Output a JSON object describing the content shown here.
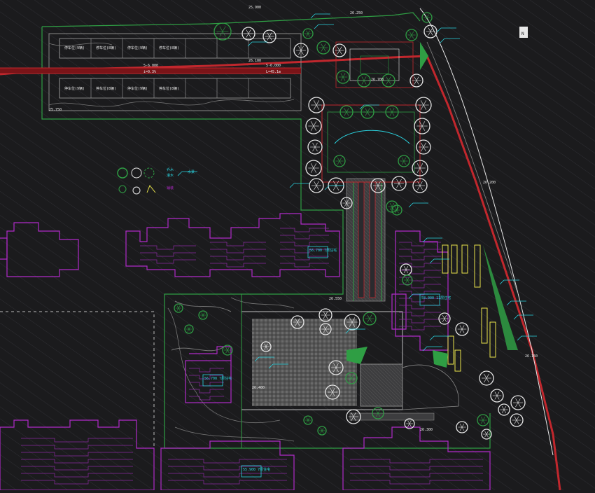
{
  "drawing": {
    "north_label": "N",
    "legend_labels": [
      "乔木",
      "灌木",
      "水景",
      "铺装"
    ],
    "elevations": [
      "25.900",
      "26.250",
      "26.100",
      "26.700",
      "26.550",
      "26.400",
      "26.300",
      "26.200",
      "25.750",
      "26.150"
    ],
    "parking_labels": [
      "停车位(9辆)",
      "停车位(8辆)",
      "停车位(9辆)",
      "停车位(8辆)",
      "停车位(9辆)",
      "停车位(8辆)",
      "停车位(9辆)",
      "停车位(8辆)"
    ],
    "road_labels": [
      "5-6.000",
      "i=0.3%",
      "5-6.000",
      "L=45.1m"
    ],
    "building_tags": [
      "56.700 7层住宅",
      "56.700 7层住宅",
      "58.000 11层住宅",
      "55.900 7层住宅"
    ]
  },
  "colors": {
    "background": "#1b1b1d",
    "boundary_red": "#c1272d",
    "building_magenta": "#b02ac8",
    "green_line": "#2f9e44",
    "cyan": "#2ad4e0",
    "white": "#e8e8e8",
    "yellow": "#e8e34a"
  }
}
